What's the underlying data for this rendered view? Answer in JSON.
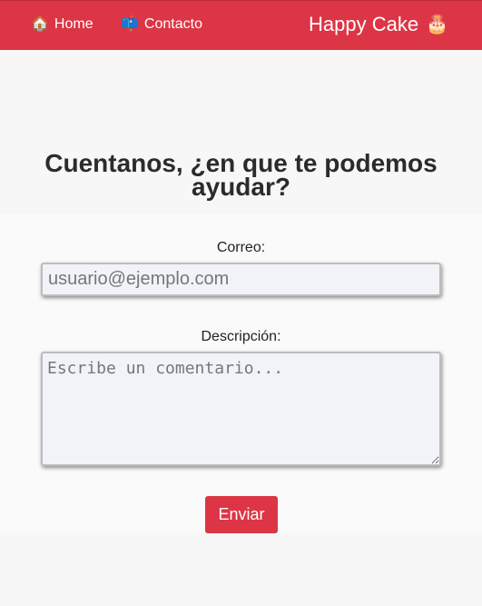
{
  "navbar": {
    "home": {
      "icon": "house-emoji-icon",
      "emoji": "🏠",
      "label": "Home"
    },
    "contact": {
      "icon": "mailbox-emoji-icon",
      "emoji": "📫",
      "label": "Contacto"
    },
    "brand": {
      "label": "Happy Cake",
      "icon": "birthday-cake-emoji-icon",
      "emoji": "🎂"
    }
  },
  "main": {
    "title": "Cuentanos, ¿en que te podemos ayudar?",
    "email": {
      "label": "Correo:",
      "placeholder": "usuario@ejemplo.com",
      "value": ""
    },
    "description": {
      "label": "Descripción:",
      "placeholder": "Escribe un comentario...",
      "value": ""
    },
    "submit_label": "Enviar"
  },
  "colors": {
    "accent": "#dc3545",
    "background": "#f7f7f7",
    "input_background": "#f1f3f8"
  }
}
